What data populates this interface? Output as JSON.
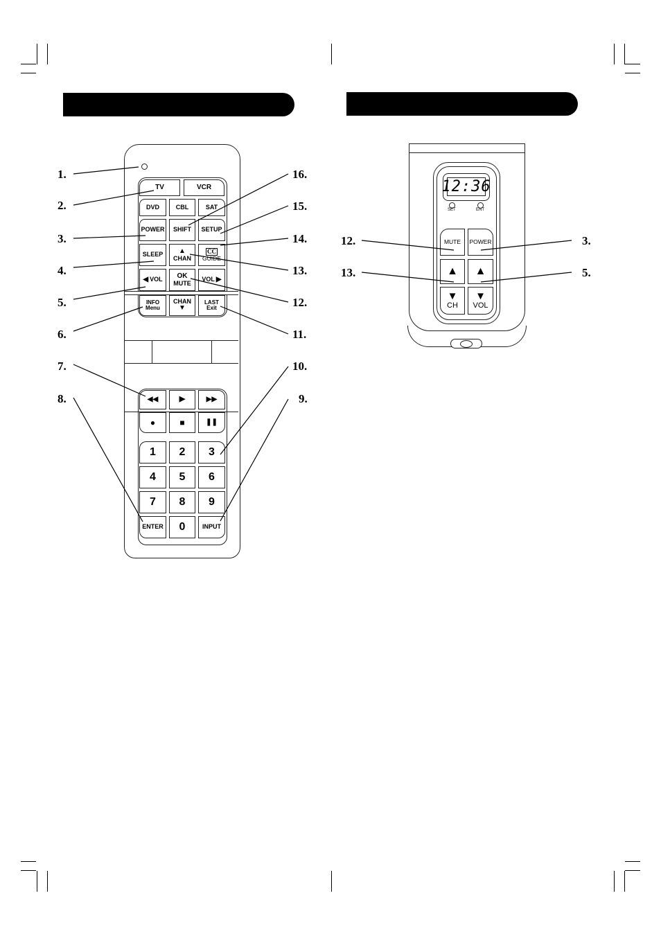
{
  "section_bars": [
    "",
    ""
  ],
  "left_remote": {
    "mode_buttons": [
      "TV",
      "VCR"
    ],
    "device_buttons": [
      "DVD",
      "CBL",
      "SAT"
    ],
    "row3": [
      "POWER",
      "SHIFT",
      "SETUP"
    ],
    "sleep": "SLEEP",
    "chan_up": {
      "glyph": "▲",
      "label": "CHAN"
    },
    "guide": {
      "glyph": "CC",
      "label": "GUIDE"
    },
    "vol_left": {
      "glyph": "◀",
      "label": "VOL"
    },
    "ok_mute": {
      "top": "OK",
      "bottom": "MUTE"
    },
    "vol_right": {
      "glyph": "▶",
      "label": "VOL"
    },
    "info_menu": {
      "top": "INFO",
      "bottom": "Menu"
    },
    "chan_down": {
      "label": "CHAN",
      "glyph": "▼"
    },
    "last_exit": {
      "top": "LAST",
      "bottom": "Exit"
    },
    "transport1": [
      "◀◀",
      "▶",
      "▶▶"
    ],
    "transport2": [
      "●",
      "■",
      "❚❚"
    ],
    "numpad": [
      "1",
      "2",
      "3",
      "4",
      "5",
      "6",
      "7",
      "8",
      "9",
      "ENTER",
      "0",
      "INPUT"
    ]
  },
  "left_callouts": [
    "1.",
    "2.",
    "3.",
    "4.",
    "5.",
    "6.",
    "7.",
    "8."
  ],
  "right_callouts": [
    "16.",
    "15.",
    "14.",
    "13.",
    "12.",
    "11.",
    "10.",
    "9."
  ],
  "right_remote": {
    "lcd_time": "12:36",
    "set_label": "SET",
    "ent_label": "ENT",
    "mute": "MUTE",
    "power": "POWER",
    "up_glyph": "▲",
    "down_glyph": "▼",
    "ch_label": "CH",
    "vol_label": "VOL"
  },
  "right_left_callouts": [
    "12.",
    "13."
  ],
  "right_right_callouts": [
    "3.",
    "5."
  ]
}
